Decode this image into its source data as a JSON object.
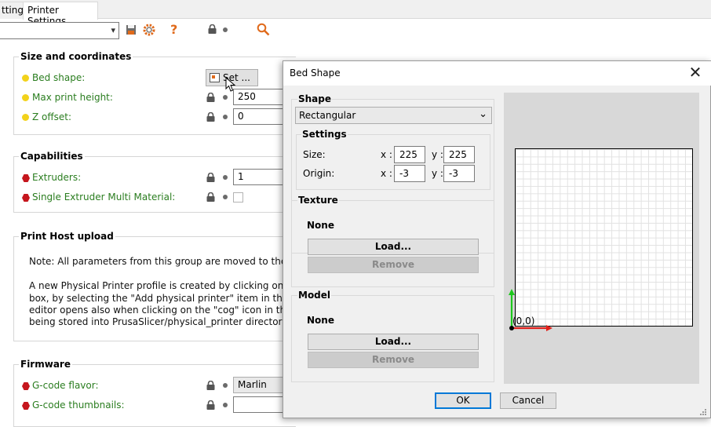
{
  "tabs": [
    {
      "label": "ttings"
    },
    {
      "label": "Printer Settings"
    }
  ],
  "toolbar": {
    "icons": [
      "save-icon",
      "cog-icon",
      "question-icon",
      "lock-icon",
      "dot-icon",
      "search-icon"
    ],
    "question_mark": "?"
  },
  "groups": {
    "size": {
      "title": "Size and coordinates",
      "bed_shape": "Bed shape:",
      "set_button": "Set ...",
      "max_print_height": "Max print height:",
      "max_print_height_value": "250",
      "z_offset": "Z offset:",
      "z_offset_value": "0"
    },
    "capabilities": {
      "title": "Capabilities",
      "extruders": "Extruders:",
      "extruders_value": "1",
      "semm": "Single Extruder Multi Material:"
    },
    "print_host": {
      "title": "Print Host upload",
      "note_line1": "Note: All parameters from this group are moved to the Physic",
      "note_line2": "A new Physical Printer profile is created by clicking on the \"co",
      "note_line3": "box, by selecting the \"Add physical printer\" item in the Printe",
      "note_line4": "editor opens also when clicking on the \"cog\" icon in the Print",
      "note_line5": "being stored into PrusaSlicer/physical_printer directory."
    },
    "firmware": {
      "title": "Firmware",
      "gcode_flavor": "G-code flavor:",
      "gcode_flavor_value": "Marlin",
      "gcode_thumbnails": "G-code thumbnails:"
    }
  },
  "dialog": {
    "title": "Bed Shape",
    "close": "✕",
    "shape": {
      "title": "Shape",
      "selected": "Rectangular",
      "settings_title": "Settings",
      "size_label": "Size:",
      "origin_label": "Origin:",
      "x_label": "x :",
      "y_label": "y :",
      "size_x": "225",
      "size_y": "225",
      "origin_x": "-3",
      "origin_y": "-3"
    },
    "texture": {
      "title": "Texture",
      "value": "None",
      "load": "Load...",
      "remove": "Remove"
    },
    "model": {
      "title": "Model",
      "value": "None",
      "load": "Load...",
      "remove": "Remove"
    },
    "preview": {
      "origin_label": "(0,0)"
    },
    "ok": "OK",
    "cancel": "Cancel"
  },
  "colors": {
    "label_green": "#2a7d1f",
    "bullet_yellow": "#f2d21b",
    "bullet_red": "#c5161d",
    "accent_blue": "#0078d7",
    "axis_x": "#e0201b",
    "axis_y": "#1dc81d"
  }
}
